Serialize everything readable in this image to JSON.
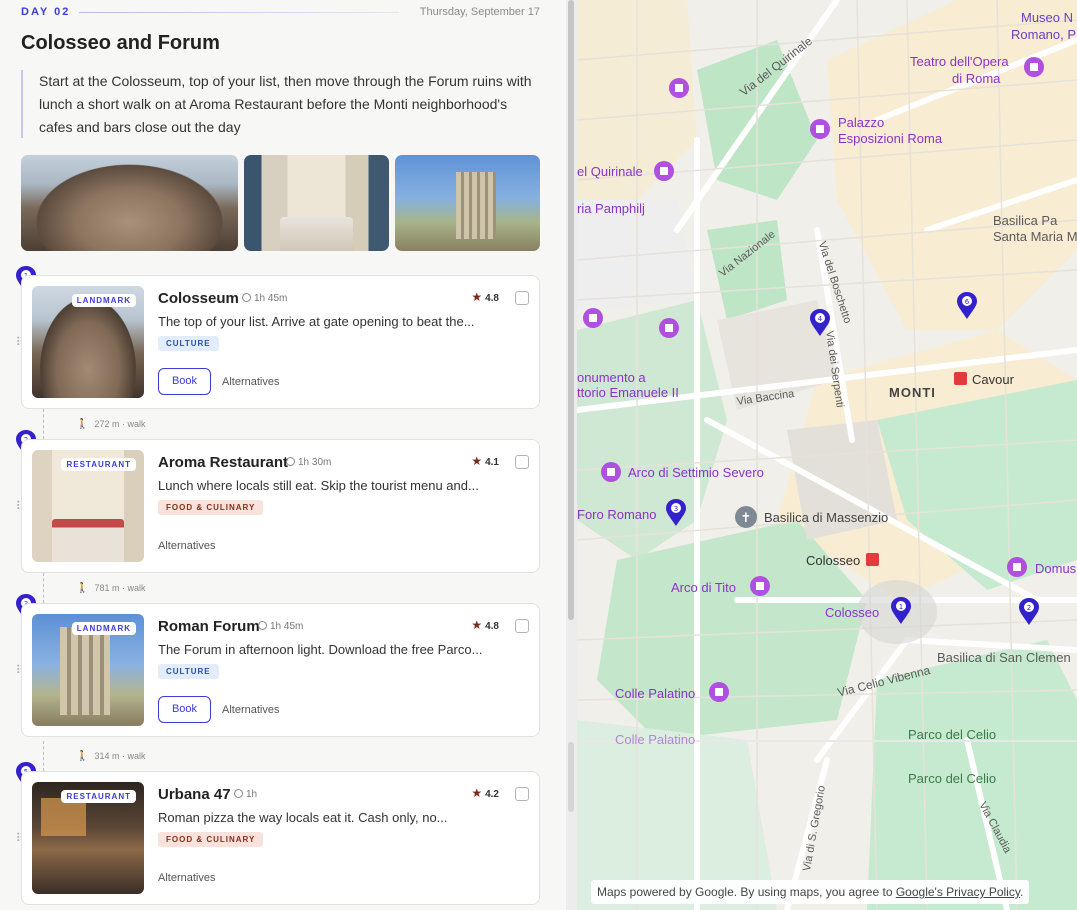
{
  "day": {
    "label": "DAY 02",
    "date": "Thursday, September 17",
    "title": "Colosseo and Forum",
    "intro": "Start at the Colosseum, top of your list, then move through the Forum ruins with lunch a short walk on at Aroma Restaurant before the Monti neighborhood's cafes and bars close out the day"
  },
  "colors": {
    "accent": "#3b3bd6",
    "rating_star": "#7a2a1a",
    "culture_bg": "#e3ecfb",
    "food_bg": "#f7e2dc"
  },
  "stops": [
    {
      "pin": "1",
      "category": "LANDMARK",
      "title": "Colosseum",
      "duration": "1h 45m",
      "rating": "4.8",
      "description": "The top of your list. Arrive at gate opening to beat the...",
      "badge": "CULTURE",
      "book_label": "Book",
      "alternatives_label": "Alternatives"
    },
    {
      "pin": "2",
      "category": "RESTAURANT",
      "title": "Aroma Restaurant",
      "duration": "1h 30m",
      "rating": "4.1",
      "description": "Lunch where locals still eat. Skip the tourist menu and...",
      "badge": "FOOD & CULINARY",
      "alternatives_label": "Alternatives"
    },
    {
      "pin": "3",
      "category": "LANDMARK",
      "title": "Roman Forum",
      "duration": "1h 45m",
      "rating": "4.8",
      "description": "The Forum in afternoon light. Download the free Parco...",
      "badge": "CULTURE",
      "book_label": "Book",
      "alternatives_label": "Alternatives"
    },
    {
      "pin": "5",
      "category": "RESTAURANT",
      "title": "Urbana 47",
      "duration": "1h",
      "rating": "4.2",
      "description": "Roman pizza the way locals eat it. Cash only, no...",
      "badge": "FOOD & CULINARY",
      "alternatives_label": "Alternatives"
    }
  ],
  "walks": [
    {
      "distance": "272 m",
      "mode": "walk"
    },
    {
      "distance": "781 m",
      "mode": "walk"
    },
    {
      "distance": "314 m",
      "mode": "walk"
    }
  ],
  "map": {
    "labels": {
      "museo": "Museo N",
      "romano": "Romano, P",
      "teatro1": "Teatro dell'Opera",
      "teatro2": "di Roma",
      "via_quirinale": "Via del Quirinale",
      "palazzo1": "Palazzo",
      "palazzo2": "Esposizioni Roma",
      "quirinale": "el Quirinale",
      "pamphilj": "ria Pamphilj",
      "basilica_pa1": "Basilica Pa",
      "basilica_pa2": "Santa Maria M",
      "via_nazionale": "Via Nazionale",
      "via_boschetto": "Via del Boschetto",
      "via_serpenti": "Via dei Serpenti",
      "monumento1": "onumento a",
      "monumento2": "ttorio Emanuele II",
      "via_baccina": "Via Baccina",
      "monti": "MONTI",
      "cavour": "Cavour",
      "arco_settimio": "Arco di Settimio Severo",
      "foro_romano": "Foro Romano",
      "massenzio": "Basilica di Massenzio",
      "colosseo_metro": "Colosseo",
      "arco_tito": "Arco di Tito",
      "colosseo": "Colosseo",
      "domus": "Domus",
      "san_clemente": "Basilica di San Clemen",
      "via_celio": "Via Celio Vibenna",
      "colle_palatino": "Colle Palatino",
      "colle_palatino2": "Colle Palatino",
      "parco_celio": "Parco del Celio",
      "parco_celio2": "Parco del Celio",
      "via_gregorio": "Via di S. Gregorio",
      "via_claudia": "Via Claudia"
    },
    "pins": [
      "4",
      "6",
      "3",
      "1",
      "2"
    ],
    "footer_text": "Maps powered by Google. By using maps, you agree to",
    "footer_link": "Google's Privacy Policy",
    "footer_end": "."
  }
}
